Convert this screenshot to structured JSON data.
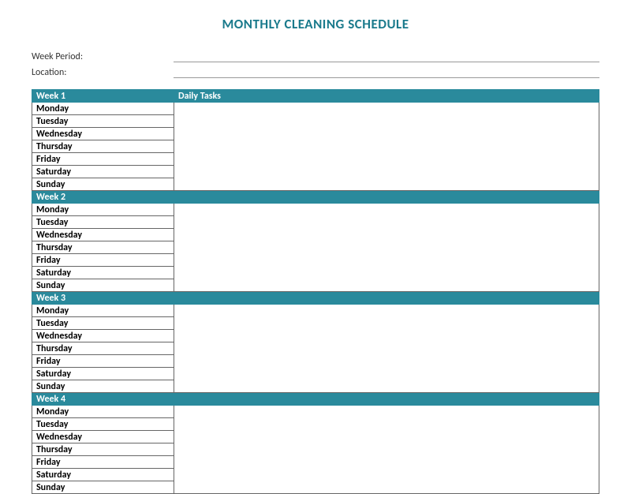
{
  "title": "MONTHLY CLEANING SCHEDULE",
  "meta": {
    "week_period_label": "Week Period:",
    "week_period_value": "",
    "location_label": "Location:",
    "location_value": ""
  },
  "columns": {
    "daily_tasks": "Daily Tasks"
  },
  "weeks": [
    {
      "label": "Week 1",
      "days": [
        "Monday",
        "Tuesday",
        "Wednesday",
        "Thursday",
        "Friday",
        "Saturday",
        "Sunday"
      ]
    },
    {
      "label": "Week 2",
      "days": [
        "Monday",
        "Tuesday",
        "Wednesday",
        "Thursday",
        "Friday",
        "Saturday",
        "Sunday"
      ]
    },
    {
      "label": "Week 3",
      "days": [
        "Monday",
        "Tuesday",
        "Wednesday",
        "Thursday",
        "Friday",
        "Saturday",
        "Sunday"
      ]
    },
    {
      "label": "Week 4",
      "days": [
        "Monday",
        "Tuesday",
        "Wednesday",
        "Thursday",
        "Friday",
        "Saturday",
        "Sunday"
      ]
    }
  ],
  "colors": {
    "accent": "#2a8a9c"
  }
}
